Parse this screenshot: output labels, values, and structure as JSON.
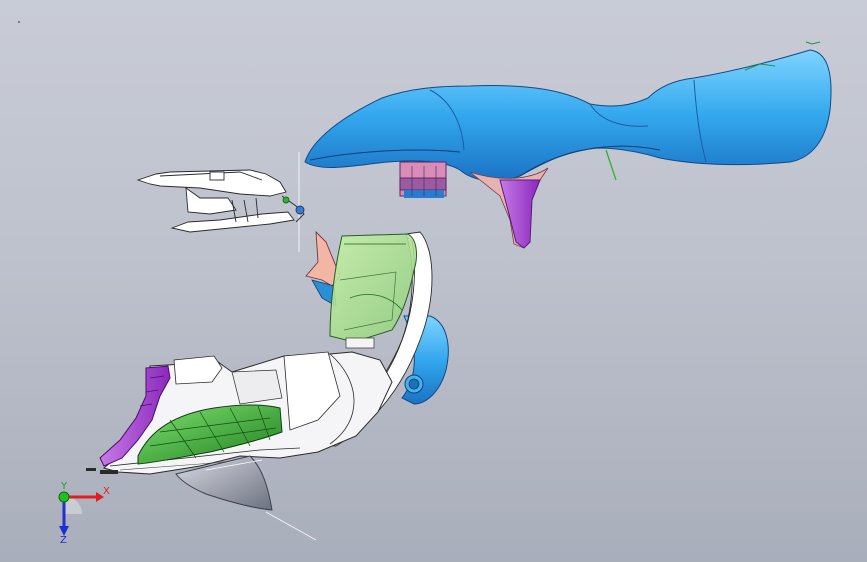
{
  "viewport": {
    "background_top": "#c9ccd6",
    "background_bottom": "#a9aebb"
  },
  "parts": [
    {
      "name": "blue-upper-housing",
      "color": "#33a8ee"
    },
    {
      "name": "purple-stand",
      "color": "#a03fd1"
    },
    {
      "name": "white-arm-linkage",
      "color": "#ffffff"
    },
    {
      "name": "green-transparent-tray",
      "color": "#a8df8a"
    },
    {
      "name": "pink-flap",
      "color": "#f0b4a8"
    },
    {
      "name": "lower-white-base",
      "color": "#f4f4f6"
    },
    {
      "name": "green-mesh-panel",
      "color": "#2f8f2f"
    },
    {
      "name": "purple-side-bracket",
      "color": "#a033cc"
    },
    {
      "name": "grey-fin-blade",
      "color": "#8a8f9c"
    },
    {
      "name": "blue-curved-guard",
      "color": "#2aa6e8"
    }
  ],
  "triad": {
    "x_label": "X",
    "y_label": "Y",
    "z_label": "Z",
    "x_color": "#e02020",
    "y_color": "#20c020",
    "z_color": "#2030d0"
  }
}
